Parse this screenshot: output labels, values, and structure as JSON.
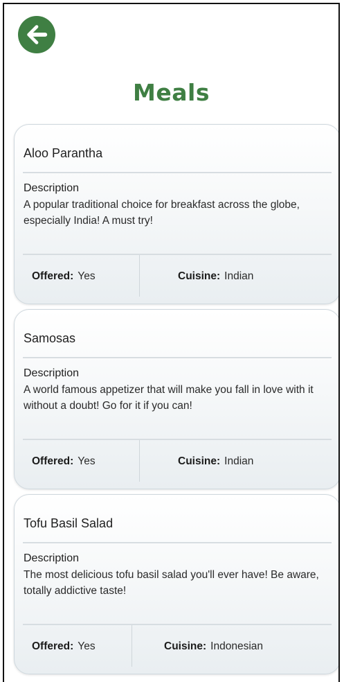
{
  "header": {
    "back_icon": "arrow-left-icon",
    "title": "Meals"
  },
  "colors": {
    "accent": "#3f7f43"
  },
  "meals": [
    {
      "name": "Aloo Parantha",
      "description_label": "Description",
      "description": "A popular traditional choice for breakfast across the globe, especially India! A must try!",
      "offered_label": "Offered:",
      "offered": "Yes",
      "cuisine_label": "Cuisine:",
      "cuisine": "Indian"
    },
    {
      "name": "Samosas",
      "description_label": "Description",
      "description": "A world famous appetizer that will make you fall in love with it without a doubt! Go for it if you can!",
      "offered_label": "Offered:",
      "offered": "Yes",
      "cuisine_label": "Cuisine:",
      "cuisine": "Indian"
    },
    {
      "name": "Tofu Basil Salad",
      "description_label": "Description",
      "description": "The most delicious tofu basil salad you'll ever have! Be aware, totally addictive taste!",
      "offered_label": "Offered:",
      "offered": "Yes",
      "cuisine_label": "Cuisine:",
      "cuisine": "Indonesian"
    }
  ]
}
